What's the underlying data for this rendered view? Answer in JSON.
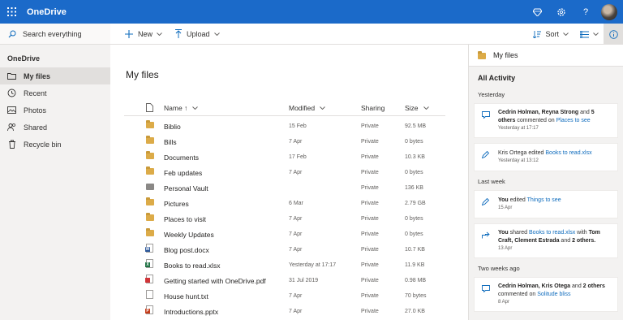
{
  "app": {
    "title": "OneDrive"
  },
  "topbar": {
    "icons": [
      "waffle-icon",
      "diamond-icon",
      "gear-icon",
      "help-icon"
    ]
  },
  "search": {
    "placeholder": "Search everything"
  },
  "nav": {
    "heading": "OneDrive",
    "items": [
      {
        "label": "My files",
        "icon": "folder-icon",
        "active": true
      },
      {
        "label": "Recent",
        "icon": "clock-icon"
      },
      {
        "label": "Photos",
        "icon": "photo-icon"
      },
      {
        "label": "Shared",
        "icon": "people-icon"
      },
      {
        "label": "Recycle bin",
        "icon": "trash-icon"
      }
    ]
  },
  "toolbar": {
    "new_label": "New",
    "upload_label": "Upload",
    "sort_label": "Sort"
  },
  "main": {
    "title": "My files",
    "columns": {
      "name": "Name ↑",
      "modified": "Modified",
      "sharing": "Sharing",
      "size": "Size"
    },
    "files": [
      {
        "name": "Biblio",
        "type": "folder",
        "modified": "15 Feb",
        "sharing": "Private",
        "size": "92.5 MB"
      },
      {
        "name": "Bills",
        "type": "folder",
        "modified": "7 Apr",
        "sharing": "Private",
        "size": "0 bytes"
      },
      {
        "name": "Documents",
        "type": "folder",
        "modified": "17 Feb",
        "sharing": "Private",
        "size": "10.3 KB"
      },
      {
        "name": "Feb updates",
        "type": "folder",
        "modified": "7 Apr",
        "sharing": "Private",
        "size": "0 bytes"
      },
      {
        "name": "Personal Vault",
        "type": "vault",
        "modified": "",
        "sharing": "Private",
        "size": "136 KB"
      },
      {
        "name": "Pictures",
        "type": "folder",
        "modified": "6 Mar",
        "sharing": "Private",
        "size": "2.79 GB"
      },
      {
        "name": "Places to visit",
        "type": "folder",
        "modified": "7 Apr",
        "sharing": "Private",
        "size": "0 bytes"
      },
      {
        "name": "Weekly Updates",
        "type": "folder",
        "modified": "7 Apr",
        "sharing": "Private",
        "size": "0 bytes"
      },
      {
        "name": "Blog post.docx",
        "type": "word",
        "modified": "7 Apr",
        "sharing": "Private",
        "size": "10.7 KB"
      },
      {
        "name": "Books to read.xlsx",
        "type": "excel",
        "modified": "Yesterday at 17:17",
        "sharing": "Private",
        "size": "11.9 KB"
      },
      {
        "name": "Getting started with OneDrive.pdf",
        "type": "pdf",
        "modified": "31 Jul 2019",
        "sharing": "Private",
        "size": "0.98 MB"
      },
      {
        "name": "House hunt.txt",
        "type": "text",
        "modified": "7 Apr",
        "sharing": "Private",
        "size": "70 bytes"
      },
      {
        "name": "Introductions.pptx",
        "type": "ppt",
        "modified": "7 Apr",
        "sharing": "Private",
        "size": "27.0 KB"
      }
    ]
  },
  "panel": {
    "header": "My files",
    "subtitle": "All Activity",
    "groups": {
      "yesterday": "Yesterday",
      "last_week": "Last week",
      "two_weeks": "Two weeks ago"
    },
    "cards": {
      "c1": {
        "who": "Cedrin Holman, Reyna Strong",
        "and": "and",
        "others": "5 others",
        "action": "commented on",
        "target": "Places to see",
        "time": "Yesterday at 17:17"
      },
      "c2": {
        "who": "Kris Ortega",
        "action": "edited",
        "target": "Books to read.xlsx",
        "time": "Yesterday at 13:12"
      },
      "c3": {
        "who": "You",
        "action": "edited",
        "target": "Things to see",
        "time": "15 Apr"
      },
      "c4": {
        "who": "You",
        "action": "shared",
        "target": "Books to read.xlsx",
        "with": "with",
        "people": "Tom Craft, Clement Estrada",
        "and": "and",
        "others": "2 others.",
        "time": "13 Apr"
      },
      "c5": {
        "who": "Cedrin Holman, Kris Otega",
        "and": "and",
        "others": "2 others",
        "action": "commented on",
        "target": "Solitude bliss",
        "time": "8 Apr"
      }
    }
  },
  "colors": {
    "brand": "#1b6ac9",
    "folder": "#dcab48",
    "link": "#0f6cbd"
  }
}
